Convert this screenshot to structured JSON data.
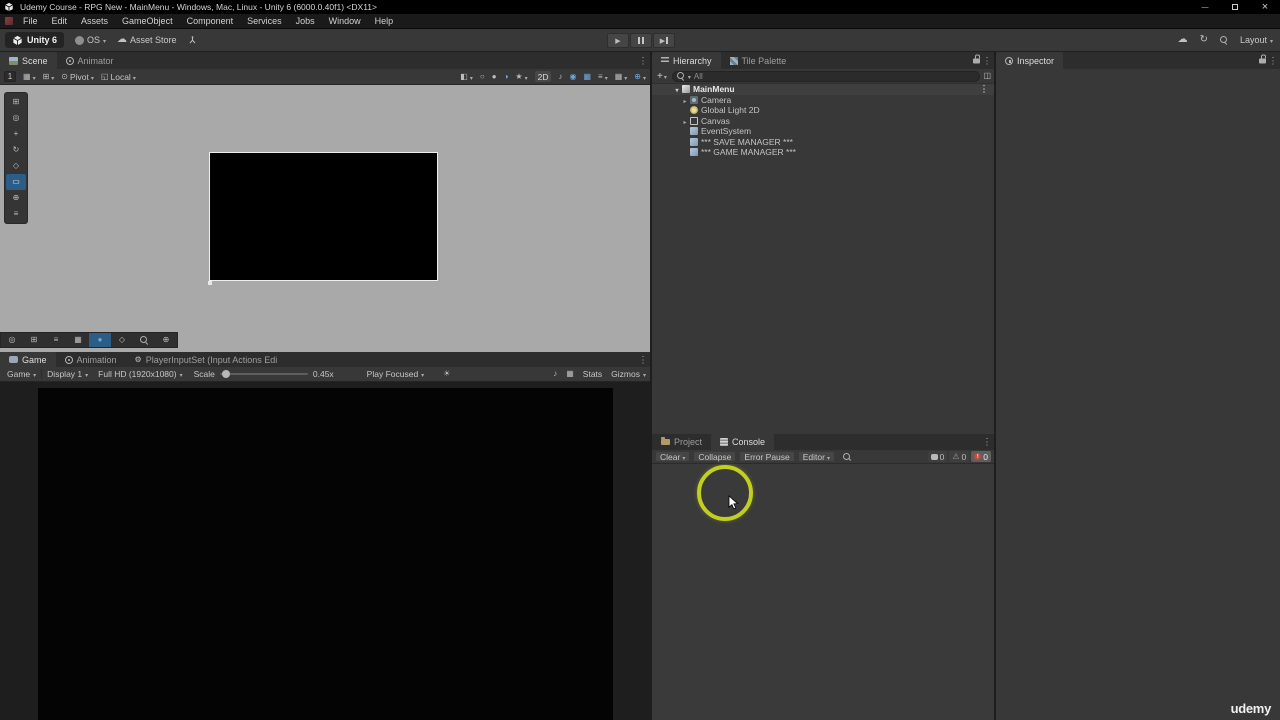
{
  "titlebar": {
    "title": "Udemy Course - RPG New - MainMenu - Windows, Mac, Linux - Unity 6 (6000.0.40f1) <DX11>"
  },
  "menubar": {
    "items": [
      "File",
      "Edit",
      "Assets",
      "GameObject",
      "Component",
      "Services",
      "Jobs",
      "Window",
      "Help"
    ]
  },
  "toolbar": {
    "version_badge": "Unity 6",
    "account_label": "OS",
    "asset_store_label": "Asset Store",
    "layout_label": "Layout"
  },
  "scene": {
    "tabs": [
      {
        "label": "Scene"
      },
      {
        "label": "Animator"
      }
    ],
    "toolbar": {
      "grid_index": "1",
      "pivot_label": "Pivot",
      "local_label": "Local",
      "mode_2d_label": "2D"
    }
  },
  "game": {
    "tabs": [
      {
        "label": "Game"
      },
      {
        "label": "Animation"
      },
      {
        "label": "PlayerInputSet (Input Actions Edi"
      }
    ],
    "toolbar": {
      "display_mode": "Game",
      "display": "Display 1",
      "resolution": "Full HD (1920x1080)",
      "scale_label": "Scale",
      "scale_value": "0.45x",
      "focus_mode": "Play Focused",
      "stats_label": "Stats",
      "gizmos_label": "Gizmos"
    }
  },
  "hierarchy": {
    "tabs": [
      {
        "label": "Hierarchy"
      },
      {
        "label": "Tile Palette"
      }
    ],
    "add_button": "+",
    "search_value": "All",
    "scene_root": "MainMenu",
    "items": [
      {
        "label": "Camera"
      },
      {
        "label": "Global Light 2D"
      },
      {
        "label": "Canvas"
      },
      {
        "label": "EventSystem"
      },
      {
        "label": "*** SAVE MANAGER ***"
      },
      {
        "label": "*** GAME MANAGER ***"
      }
    ]
  },
  "console": {
    "tabs": [
      {
        "label": "Project"
      },
      {
        "label": "Console"
      }
    ],
    "toolbar": {
      "clear_label": "Clear",
      "collapse_label": "Collapse",
      "error_pause_label": "Error Pause",
      "editor_label": "Editor",
      "info_count": "0",
      "warning_count": "0",
      "error_count": "0"
    }
  },
  "inspector": {
    "tab_label": "Inspector"
  },
  "watermark": {
    "text": "udemy"
  },
  "colors": {
    "accent_blue": "#2C5D87",
    "active_icon_blue": "#6FA8DC",
    "annotation_yellow": "#C3CF1E",
    "scene_background": "#A9A9A9"
  }
}
